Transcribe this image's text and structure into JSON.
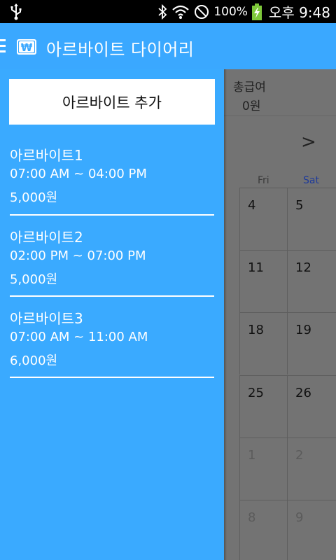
{
  "status_bar": {
    "battery": "100%",
    "time": "오후 9:48",
    "icons": [
      "usb-icon",
      "bluetooth-icon",
      "wifi-icon",
      "no-signal-icon",
      "battery-charging-icon"
    ]
  },
  "app_bar": {
    "title": "아르바이트 다이어리",
    "logo_symbol": "₩"
  },
  "drawer": {
    "add_button": "아르바이트 추가",
    "jobs": [
      {
        "name": "아르바이트1",
        "time": "07:00 AM ~ 04:00 PM",
        "wage": "5,000원"
      },
      {
        "name": "아르바이트2",
        "time": "02:00 PM ~ 07:00 PM",
        "wage": "5,000원"
      },
      {
        "name": "아르바이트3",
        "time": "07:00 AM ~ 11:00 AM",
        "wage": "6,000원"
      }
    ]
  },
  "background": {
    "salary_label": "총급여",
    "salary_value": "0원",
    "next_month": ">",
    "days_of_week": [
      "Fri",
      "Sat"
    ],
    "calendar_rows": [
      [
        "4",
        "5"
      ],
      [
        "11",
        "12"
      ],
      [
        "18",
        "19"
      ],
      [
        "25",
        "26"
      ],
      [
        "1",
        "2"
      ],
      [
        "8",
        "9"
      ]
    ],
    "other_month_rows": [
      4,
      5
    ]
  },
  "colors": {
    "accent": "#3aa8ff",
    "drawer": "#3aaaff",
    "overlay": "#737373",
    "saturday": "#1f3b9a"
  }
}
